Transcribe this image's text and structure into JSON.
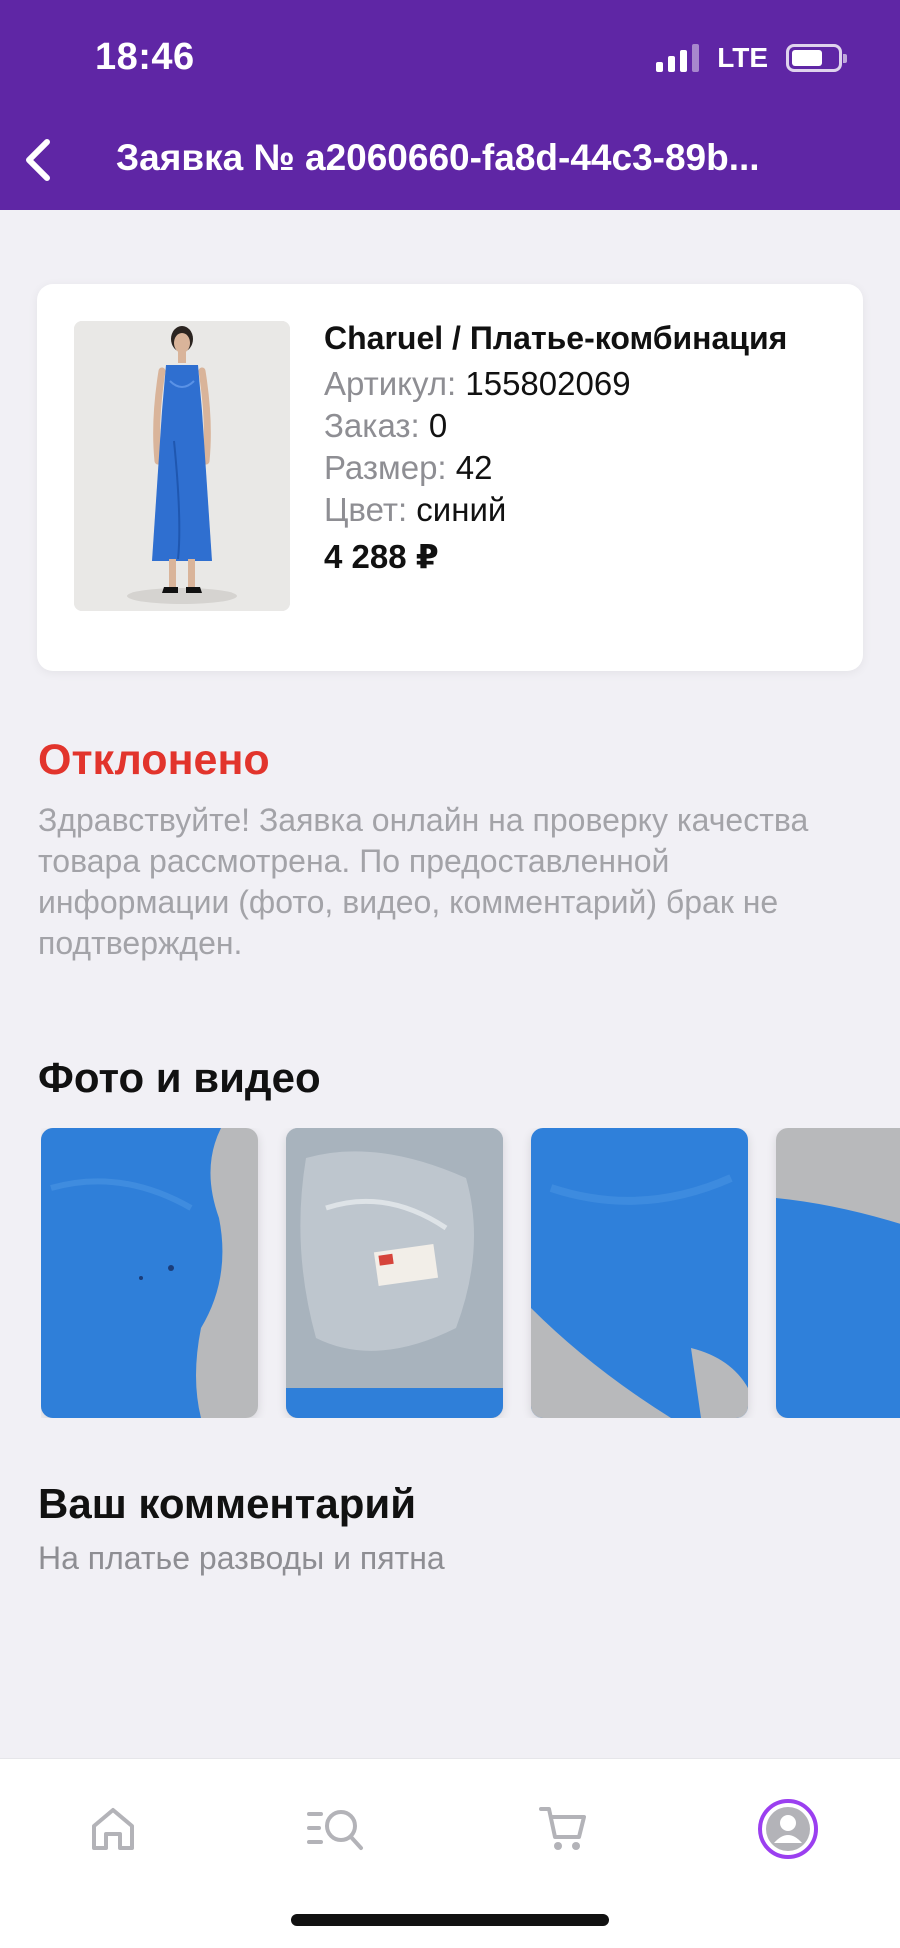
{
  "status_bar": {
    "time": "18:46",
    "network": "LTE"
  },
  "header": {
    "title": "Заявка № a2060660-fa8d-44c3-89b..."
  },
  "product": {
    "name": "Charuel / Платье-комбинация",
    "article_label": "Артикул:",
    "article_value": "155802069",
    "order_label": "Заказ:",
    "order_value": "0",
    "size_label": "Размер:",
    "size_value": "42",
    "color_label": "Цвет:",
    "color_value": "синий",
    "price": "4 288 ₽"
  },
  "claim": {
    "status": "Отклонено",
    "message": "Здравствуйте! Заявка онлайн на проверку качества товара рассмотрена. По предоставленной информации (фото, видео, комментарий) брак не подтвержден."
  },
  "media": {
    "title": "Фото и видео"
  },
  "comment": {
    "title": "Ваш комментарий",
    "text": "На платье разводы и пятна"
  },
  "colors": {
    "header": "#5f26a5",
    "status_rejected": "#e2342c",
    "accent": "#9b3ff0",
    "tab_icon": "#b3b3b8"
  },
  "tabbar": {
    "icons": [
      "home-icon",
      "catalog-search-icon",
      "cart-icon",
      "profile-icon"
    ],
    "active": "profile-icon"
  }
}
